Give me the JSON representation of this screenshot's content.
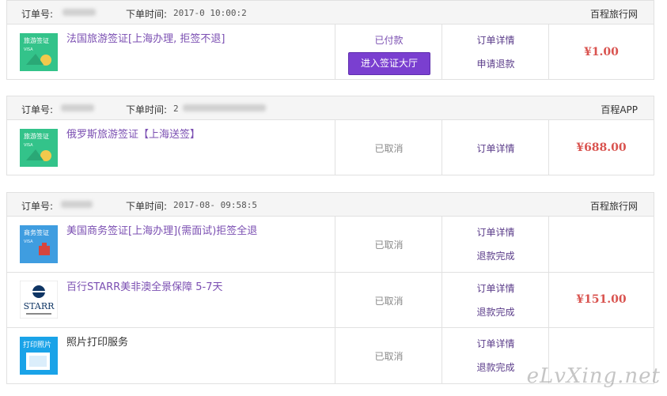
{
  "orders": [
    {
      "header": {
        "order_label": "订单号:",
        "time_label": "下单时间:",
        "time_value": "2017-0  10:00:2",
        "site": "百程旅行网"
      },
      "items": [
        {
          "name": "法国旅游签证[上海办理, 拒签不退]",
          "thumb_title": "旅游签证",
          "thumb_sub": "VISA",
          "status": "已付款",
          "button": "进入签证大厅",
          "action1": "订单详情",
          "action2": "申请退款",
          "price": "¥1.00"
        }
      ]
    },
    {
      "header": {
        "order_label": "订单号:",
        "time_label": "下单时间:",
        "time_value": "2",
        "site": "百程APP"
      },
      "items": [
        {
          "name": "俄罗斯旅游签证【上海送签】",
          "thumb_title": "旅游签证",
          "thumb_sub": "VISA",
          "status": "已取消",
          "action1": "订单详情",
          "price": "¥688.00"
        }
      ]
    },
    {
      "header": {
        "order_label": "订单号:",
        "time_label": "下单时间:",
        "time_value": "2017-08- 09:58:5",
        "site": "百程旅行网"
      },
      "items": [
        {
          "name": "美国商务签证[上海办理](需面试)拒签全退",
          "thumb_title": "商务签证",
          "thumb_sub": "VISA",
          "status": "已取消",
          "action1": "订单详情",
          "action2": "退款完成"
        },
        {
          "name": "百行STARR美非澳全景保障 5-7天",
          "thumb_title": "STARR",
          "status": "已取消",
          "action1": "订单详情",
          "action2": "退款完成"
        },
        {
          "name": "照片打印服务",
          "thumb_title": "打印照片",
          "status": "已取消",
          "action1": "订单详情",
          "action2": "退款完成"
        }
      ],
      "price": "¥151.00"
    }
  ],
  "watermark": "eLvXing.net"
}
